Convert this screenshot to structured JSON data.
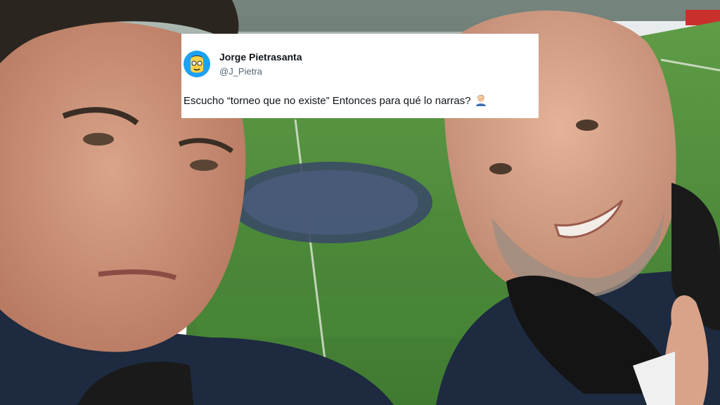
{
  "tweet": {
    "author_name": "Jorge Pietrasanta",
    "author_handle": "@J_Pietra",
    "text": "Escucho “torneo que no existe” Entonces para qué lo narras?",
    "emoji_icon": "person-facepalming-icon"
  },
  "colors": {
    "pitch_green": "#4f8f3c",
    "jacket_navy": "#1d2a40",
    "card_background": "#ffffff"
  }
}
